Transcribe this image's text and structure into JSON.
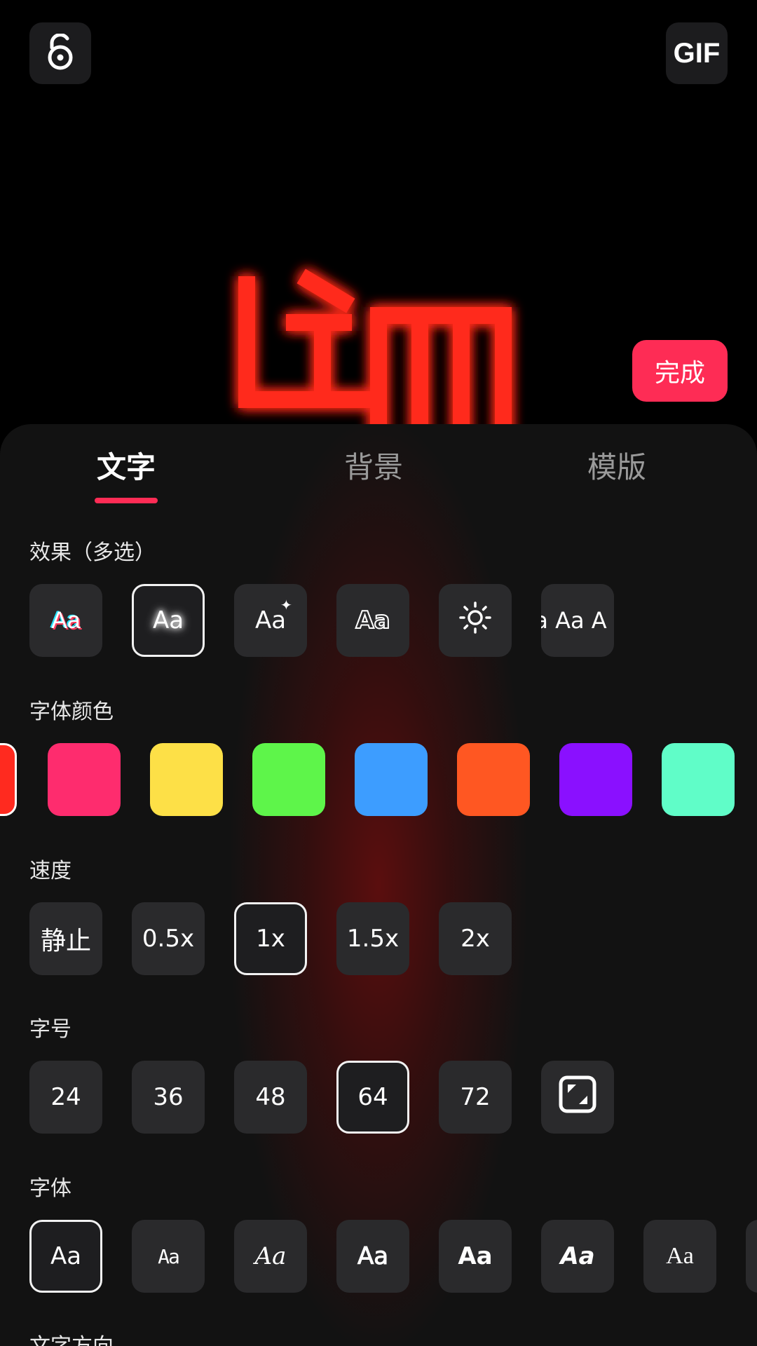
{
  "header": {
    "gif_label": "GIF",
    "done_label": "完成"
  },
  "preview": {
    "glow_color": "#ff2a1f"
  },
  "tabs": [
    {
      "label": "文字",
      "active": true
    },
    {
      "label": "背景",
      "active": false
    },
    {
      "label": "模版",
      "active": false
    }
  ],
  "sections": {
    "effects": {
      "label": "效果（多选）",
      "items": [
        {
          "label": "Aa",
          "style": "glitch"
        },
        {
          "label": "Aa",
          "style": "glow",
          "selected": true
        },
        {
          "label": "Aa",
          "style": "sparkle"
        },
        {
          "label": "Aa",
          "style": "outline"
        },
        {
          "label": "",
          "style": "brightness",
          "icon": "sun-icon"
        },
        {
          "label": "a Aa A",
          "style": "marquee"
        }
      ]
    },
    "font_color": {
      "label": "字体颜色",
      "colors": [
        "#ff2a1f",
        "#fe2c6e",
        "#fde047",
        "#5ef54a",
        "#3d9dff",
        "#ff5722",
        "#8a10ff",
        "#60fdc8"
      ]
    },
    "speed": {
      "label": "速度",
      "options": [
        "静止",
        "0.5x",
        "1x",
        "1.5x",
        "2x"
      ],
      "selected": "1x"
    },
    "font_size": {
      "label": "字号",
      "options": [
        "24",
        "36",
        "48",
        "64",
        "72"
      ],
      "selected": "64",
      "custom_icon": "resize-icon"
    },
    "font": {
      "label": "字体",
      "options": [
        "Aa",
        "Aa",
        "Aa",
        "Aa",
        "Aa",
        "Aa",
        "Aa"
      ]
    },
    "direction": {
      "label": "文字方向"
    }
  },
  "colors": {
    "accent": "#fe2c55",
    "panel_bg": "#121212",
    "tile_bg": "#2a2a2c"
  }
}
